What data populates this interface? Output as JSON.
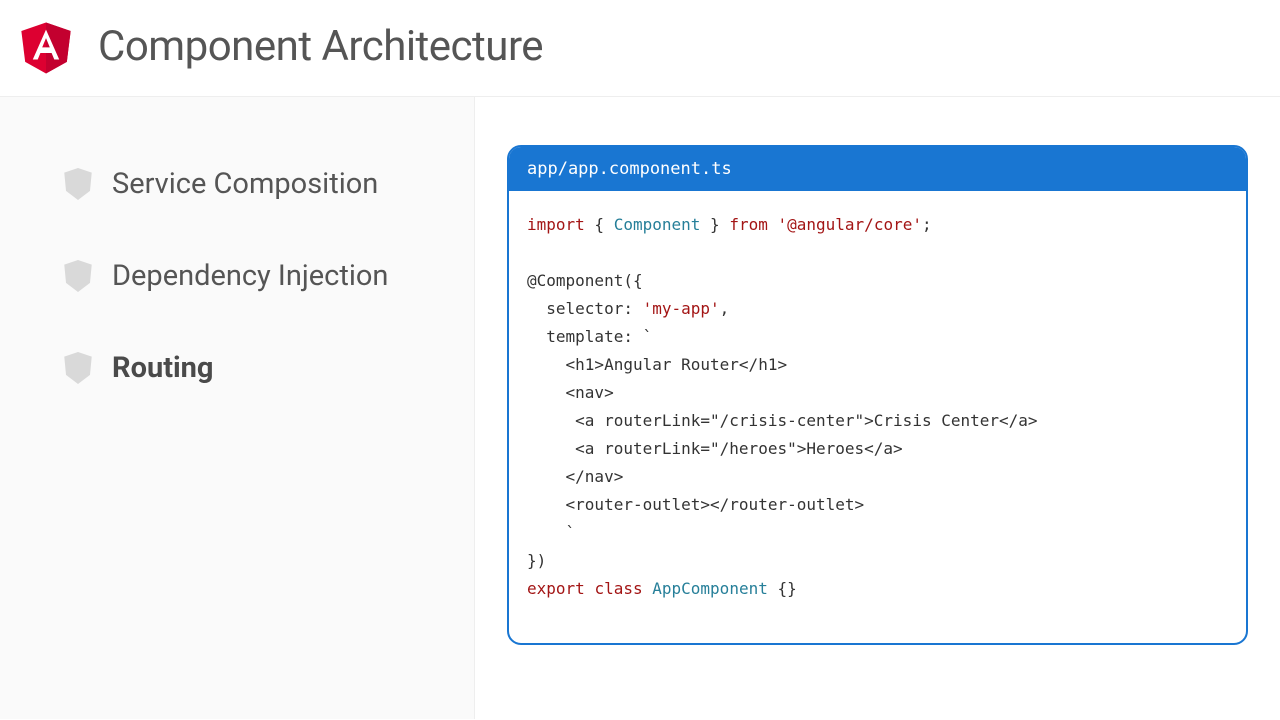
{
  "header": {
    "title": "Component Architecture"
  },
  "sidebar": {
    "items": [
      {
        "label": "Service Composition",
        "active": false
      },
      {
        "label": "Dependency Injection",
        "active": false
      },
      {
        "label": "Routing",
        "active": true
      }
    ]
  },
  "code_card": {
    "filename": "app/app.component.ts",
    "code": {
      "kw_import": "import",
      "import_braces": " { ",
      "import_symbol": "Component",
      "import_braces_close": " } ",
      "kw_from": "from",
      "import_module": "'@angular/core'",
      "import_end": ";",
      "decorator": "@Component",
      "open_paren": "({",
      "selector_key": "  selector: ",
      "selector_val": "'my-app'",
      "comma1": ",",
      "template_key": "  template: ",
      "template_tick": "`",
      "tpl_l1": "    <h1>Angular Router</h1>",
      "tpl_l2": "    <nav>",
      "tpl_l3": "     <a routerLink=\"/crisis-center\">Crisis Center</a>",
      "tpl_l4": "     <a routerLink=\"/heroes\">Heroes</a>",
      "tpl_l5": "    </nav>",
      "tpl_l6": "    <router-outlet></router-outlet>",
      "tpl_l7": "    `",
      "close_paren": "})",
      "kw_export": "export",
      "kw_class": "class",
      "class_name": "AppComponent",
      "class_body": " {}"
    }
  },
  "colors": {
    "brand_red": "#dd0031",
    "brand_red_dark": "#c3002f",
    "accent_blue": "#1976d2",
    "text_muted": "#555",
    "sidebar_bg": "#fafafa"
  }
}
